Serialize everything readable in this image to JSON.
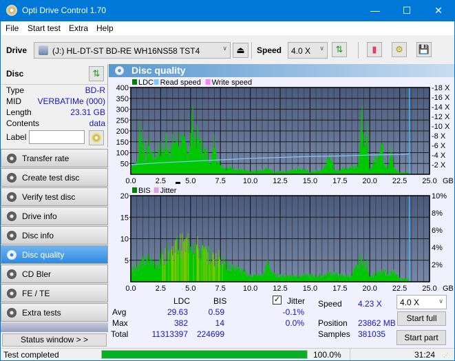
{
  "window": {
    "title": "Opti Drive Control 1.70",
    "min": "—",
    "max": "☐",
    "close": "✕"
  },
  "menu": [
    "File",
    "Start test",
    "Extra",
    "Help"
  ],
  "toolbar": {
    "drive_label": "Drive",
    "drive_value": "(J:)  HL-DT-ST BD-RE  WH16NS58 TST4",
    "speed_label": "Speed",
    "speed_value": "4.0 X"
  },
  "disc": {
    "header": "Disc",
    "rows": [
      {
        "k": "Type",
        "v": "BD-R"
      },
      {
        "k": "MID",
        "v": "VERBATIMe (000)"
      },
      {
        "k": "Length",
        "v": "23.31 GB"
      },
      {
        "k": "Contents",
        "v": "data"
      }
    ],
    "label_key": "Label",
    "label_value": ""
  },
  "nav": [
    {
      "label": "Transfer rate",
      "active": false
    },
    {
      "label": "Create test disc",
      "active": false
    },
    {
      "label": "Verify test disc",
      "active": false
    },
    {
      "label": "Drive info",
      "active": false
    },
    {
      "label": "Disc info",
      "active": false
    },
    {
      "label": "Disc quality",
      "active": true
    },
    {
      "label": "CD Bler",
      "active": false
    },
    {
      "label": "FE / TE",
      "active": false
    },
    {
      "label": "Extra tests",
      "active": false
    }
  ],
  "status_window_label": "Status window > >",
  "panel_title": "Disc quality",
  "chart_data": [
    {
      "type": "bar",
      "title": "LDC",
      "legend": [
        {
          "name": "LDC",
          "color": "#008000"
        },
        {
          "name": "Read speed",
          "color": "#80c8ff"
        },
        {
          "name": "Write speed",
          "color": "#ff80ff"
        }
      ],
      "legend_placement": "top-left",
      "xlabel": "GB",
      "x_ticks": [
        "0.0",
        "2.5",
        "5.0",
        "7.5",
        "10.0",
        "12.5",
        "15.0",
        "17.5",
        "20.0",
        "22.5",
        "25.0"
      ],
      "xlim": [
        0,
        25
      ],
      "y_ticks": [
        50,
        100,
        150,
        200,
        250,
        300,
        350,
        400
      ],
      "ylim": [
        0,
        400
      ],
      "y2_ticks": [
        "2 X",
        "4 X",
        "6 X",
        "8 X",
        "10 X",
        "12 X",
        "14 X",
        "16 X",
        "18 X"
      ],
      "y2lim": [
        0,
        18
      ],
      "end_marker_gb": 23.31,
      "ldc_envelope": [
        [
          0,
          55
        ],
        [
          0.3,
          70
        ],
        [
          0.6,
          80
        ],
        [
          0.8,
          375
        ],
        [
          0.9,
          110
        ],
        [
          1.0,
          290
        ],
        [
          1.2,
          100
        ],
        [
          1.5,
          190
        ],
        [
          1.8,
          125
        ],
        [
          2.0,
          110
        ],
        [
          2.2,
          130
        ],
        [
          2.4,
          180
        ],
        [
          2.6,
          150
        ],
        [
          2.8,
          140
        ],
        [
          3.0,
          240
        ],
        [
          3.2,
          150
        ],
        [
          3.5,
          190
        ],
        [
          3.8,
          210
        ],
        [
          4.0,
          225
        ],
        [
          4.3,
          200
        ],
        [
          4.6,
          180
        ],
        [
          4.8,
          150
        ],
        [
          5.0,
          210
        ],
        [
          5.1,
          380
        ],
        [
          5.3,
          250
        ],
        [
          5.6,
          230
        ],
        [
          5.9,
          180
        ],
        [
          6.2,
          150
        ],
        [
          6.5,
          110
        ],
        [
          6.8,
          100
        ],
        [
          7.0,
          280
        ],
        [
          7.2,
          100
        ],
        [
          7.5,
          80
        ],
        [
          7.7,
          50
        ],
        [
          8.0,
          40
        ],
        [
          8.5,
          40
        ],
        [
          9.0,
          35
        ],
        [
          9.5,
          25
        ],
        [
          10.0,
          15
        ],
        [
          11.0,
          25
        ],
        [
          11.5,
          40
        ],
        [
          12.0,
          15
        ],
        [
          13.0,
          20
        ],
        [
          14.0,
          40
        ],
        [
          15.0,
          15
        ],
        [
          16.0,
          25
        ],
        [
          16.8,
          130
        ],
        [
          17.0,
          20
        ],
        [
          18.0,
          40
        ],
        [
          19.0,
          60
        ],
        [
          19.4,
          375
        ],
        [
          19.6,
          110
        ],
        [
          19.8,
          275
        ],
        [
          20.0,
          20
        ],
        [
          21.0,
          200
        ],
        [
          21.2,
          80
        ],
        [
          21.5,
          50
        ],
        [
          21.8,
          160
        ],
        [
          22.0,
          40
        ],
        [
          22.5,
          10
        ],
        [
          23.3,
          10
        ]
      ],
      "read_speed_x": [
        [
          0,
          2.0
        ],
        [
          2.5,
          2.4
        ],
        [
          5.0,
          2.7
        ],
        [
          7.5,
          3.0
        ],
        [
          10.0,
          3.3
        ],
        [
          12.5,
          3.5
        ],
        [
          15.0,
          3.7
        ],
        [
          17.5,
          3.8
        ],
        [
          20.0,
          4.0
        ],
        [
          22.5,
          4.1
        ],
        [
          23.31,
          4.2
        ]
      ]
    },
    {
      "type": "bar",
      "title": "BIS",
      "legend": [
        {
          "name": "BIS",
          "color": "#008000"
        },
        {
          "name": "Jitter",
          "color": "#e0a0e0"
        }
      ],
      "legend_placement": "top-left",
      "xlabel": "GB",
      "x_ticks": [
        "0.0",
        "2.5",
        "5.0",
        "7.5",
        "10.0",
        "12.5",
        "15.0",
        "17.5",
        "20.0",
        "22.5",
        "25.0"
      ],
      "xlim": [
        0,
        25
      ],
      "y_ticks": [
        5,
        10,
        15,
        20
      ],
      "ylim": [
        0,
        20
      ],
      "y2_ticks": [
        "2%",
        "4%",
        "6%",
        "8%",
        "10%"
      ],
      "y2lim": [
        0,
        10
      ],
      "end_marker_gb": 23.31,
      "bis_envelope": [
        [
          0,
          5
        ],
        [
          0.5,
          5
        ],
        [
          1.0,
          6
        ],
        [
          1.5,
          7
        ],
        [
          2.0,
          6
        ],
        [
          2.5,
          7
        ],
        [
          3.0,
          9
        ],
        [
          3.5,
          10
        ],
        [
          4.0,
          12
        ],
        [
          4.5,
          11
        ],
        [
          5.0,
          14
        ],
        [
          5.3,
          12
        ],
        [
          5.8,
          10
        ],
        [
          6.3,
          9
        ],
        [
          7.0,
          7
        ],
        [
          7.5,
          8
        ],
        [
          8.0,
          5
        ],
        [
          8.5,
          5
        ],
        [
          9.0,
          4
        ],
        [
          9.5,
          3
        ],
        [
          10.0,
          2
        ],
        [
          11.0,
          2
        ],
        [
          11.5,
          6
        ],
        [
          12.0,
          2
        ],
        [
          13.0,
          2
        ],
        [
          14.0,
          2
        ],
        [
          15.0,
          2
        ],
        [
          16.0,
          2
        ],
        [
          16.8,
          3
        ],
        [
          17.5,
          2
        ],
        [
          18.5,
          2
        ],
        [
          19.4,
          8
        ],
        [
          19.6,
          4
        ],
        [
          19.8,
          6
        ],
        [
          20.0,
          2
        ],
        [
          21.0,
          3
        ],
        [
          22.0,
          3
        ],
        [
          22.5,
          1
        ],
        [
          23.3,
          1
        ]
      ]
    }
  ],
  "stats": {
    "col_ldc": "LDC",
    "col_bis": "BIS",
    "jitter_checked": true,
    "jitter_label": "Jitter",
    "rows": [
      {
        "label": "Avg",
        "ldc": "29.63",
        "bis": "0.59",
        "jitter": "-0.1%"
      },
      {
        "label": "Max",
        "ldc": "382",
        "bis": "14",
        "jitter": "0.0%"
      },
      {
        "label": "Total",
        "ldc": "11313397",
        "bis": "224699",
        "jitter": ""
      }
    ],
    "speed_label": "Speed",
    "speed_value": "4.23 X",
    "position_label": "Position",
    "position_value": "23862 MB",
    "samples_label": "Samples",
    "samples_value": "381035",
    "speed_select": "4.0 X",
    "start_full": "Start full",
    "start_part": "Start part"
  },
  "status": {
    "text": "Test completed",
    "progress_percent": 100.0,
    "progress_label": "100.0%",
    "elapsed": "31:24"
  }
}
